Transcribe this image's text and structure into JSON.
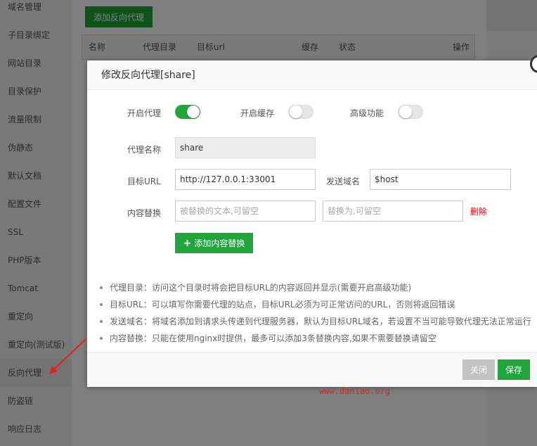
{
  "sidebar": {
    "items": [
      {
        "label": "域名管理"
      },
      {
        "label": "子目录绑定"
      },
      {
        "label": "网站目录"
      },
      {
        "label": "目录保护"
      },
      {
        "label": "流量限制"
      },
      {
        "label": "伪静态"
      },
      {
        "label": "默认文档"
      },
      {
        "label": "配置文件"
      },
      {
        "label": "SSL"
      },
      {
        "label": "PHP版本"
      },
      {
        "label": "Tomcat"
      },
      {
        "label": "重定向"
      },
      {
        "label": "重定向(测试版)"
      },
      {
        "label": "反向代理"
      },
      {
        "label": "防盗链"
      },
      {
        "label": "响应日志"
      }
    ],
    "active": "反向代理"
  },
  "background": {
    "add_button": "添加反向代理",
    "columns": [
      "名称",
      "代理目录",
      "目标url",
      "缓存",
      "状态",
      "操作"
    ]
  },
  "modal": {
    "title": "修改反向代理[share]",
    "toggles": {
      "proxy": {
        "label": "开启代理",
        "on": true
      },
      "cache": {
        "label": "开启缓存",
        "on": false
      },
      "advanced": {
        "label": "高级功能",
        "on": false
      }
    },
    "fields": {
      "name_label": "代理名称",
      "name_value": "share",
      "target_label": "目标URL",
      "target_value": "http://127.0.0.1:33001",
      "host_label": "发送域名",
      "host_value": "$host",
      "replace_label": "内容替换",
      "replace_from_placeholder": "被替换的文本,可留空",
      "replace_to_placeholder": "替换为,可留空",
      "delete_label": "删除"
    },
    "add_replace_button": "添加内容替换",
    "tips": [
      "代理目录：访问这个目录时将会把目标URL的内容返回并显示(需要开启高级功能)",
      "目标URL：可以填写你需要代理的站点，目标URL必须为可正常访问的URL，否则将返回错误",
      "发送域名：将域名添加到请求头传递到代理服务器，默认为目标URL域名，若设置不当可能导致代理无法正常运行",
      "内容替换：只能在使用nginx时提供，最多可以添加3条替换内容,如果不需要替换请留空"
    ],
    "close_button": "关闭",
    "save_button": "保存"
  },
  "watermark": "www.daniao.org",
  "colors": {
    "accent": "#20a53a",
    "danger": "#e00000",
    "watermark": "#e02020"
  }
}
